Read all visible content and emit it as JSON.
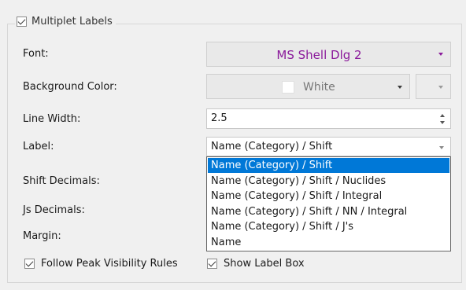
{
  "group": {
    "title": "Multiplet Labels",
    "checked": true
  },
  "fields": {
    "font_label": "Font:",
    "font_value": "MS Shell Dlg 2",
    "bg_label": "Background Color:",
    "bg_value": "White",
    "line_width_label": "Line Width:",
    "line_width_value": "2.5",
    "label_label": "Label:",
    "label_value": "Name (Category) / Shift",
    "shift_decimals_label": "Shift Decimals:",
    "js_decimals_label": "Js Decimals:",
    "margin_label": "Margin:"
  },
  "dropdown": {
    "options": [
      "Name (Category) / Shift",
      "Name (Category) / Shift / Nuclides",
      "Name (Category) / Shift / Integral",
      "Name (Category) / Shift / NN / Integral",
      "Name (Category) / Shift / J's",
      "Name"
    ],
    "selected_index": 0
  },
  "checkboxes": {
    "follow_peak": {
      "label": "Follow Peak Visibility Rules",
      "checked": true
    },
    "show_label_box": {
      "label": "Show Label Box",
      "checked": true
    }
  },
  "colors": {
    "font_text": "#8b1a9b",
    "selection": "#0078d7"
  }
}
